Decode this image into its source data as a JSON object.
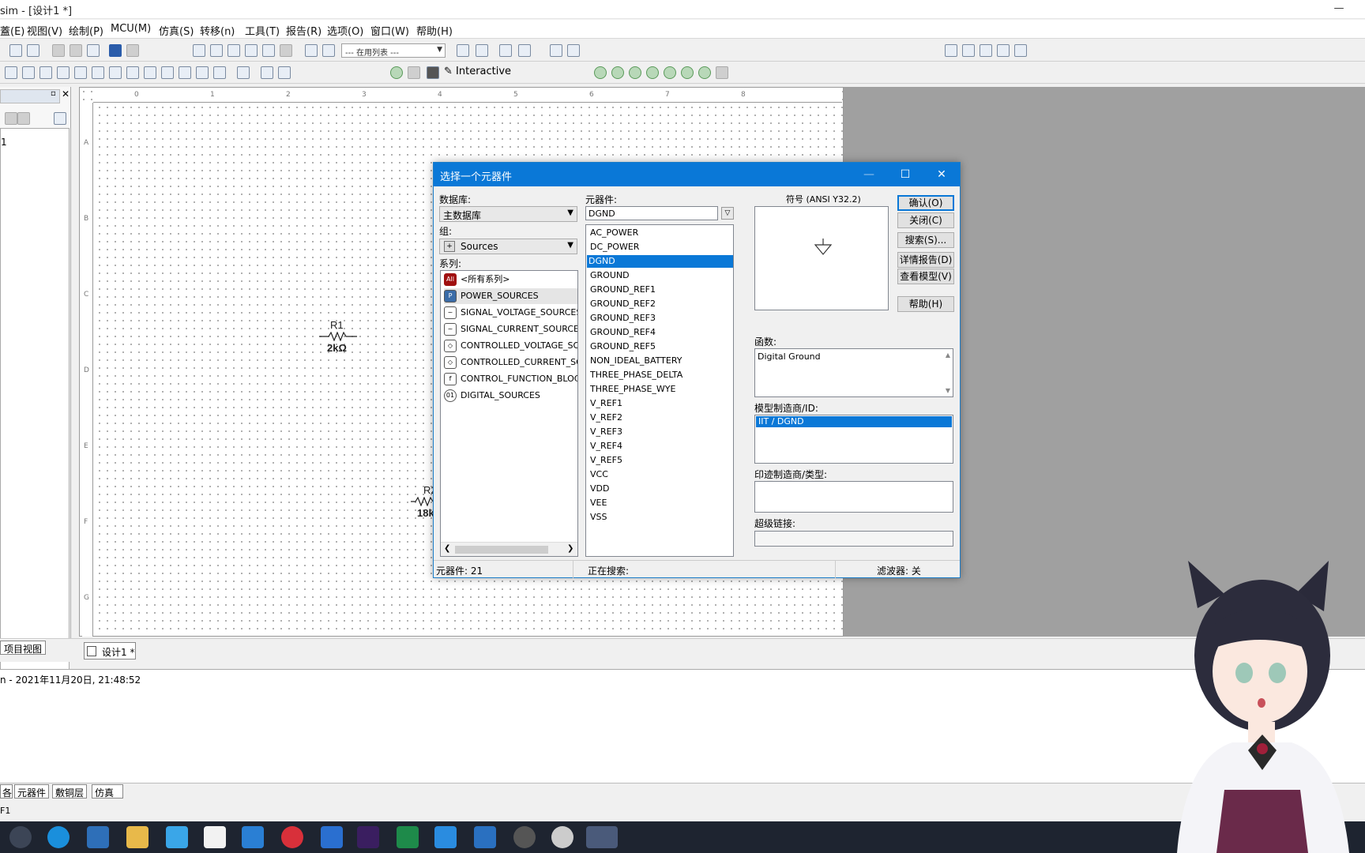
{
  "window": {
    "title": "sim - [设计1 *]",
    "minimize": "—"
  },
  "menu": [
    "蓋(E)",
    "视图(V)",
    "绘制(P)",
    "MCU(M)",
    "仿真(S)",
    "转移(n)",
    "工具(T)",
    "报告(R)",
    "选项(O)",
    "窗口(W)",
    "帮助(H)"
  ],
  "toolbar": {
    "in_use_list": "--- 在用列表 ---",
    "interactive": "Interactive"
  },
  "left_panel": {
    "tab": "项目视图",
    "item": "1"
  },
  "canvas": {
    "ruler_top": [
      "0",
      "1",
      "2",
      "3",
      "4",
      "5",
      "6",
      "7",
      "8"
    ],
    "ruler_left": [
      "A",
      "B",
      "C",
      "D",
      "E",
      "F",
      "G"
    ],
    "components": {
      "r1_name": "R1",
      "r1_value": "2kΩ",
      "r2_name": "R2",
      "r2_value": "18k"
    }
  },
  "doc_tab": "设计1 *",
  "log": {
    "line": "n  -  2021年11月20日, 21:48:52"
  },
  "bottom_tabs": [
    "各",
    "元器件",
    "敷铜层",
    "仿真"
  ],
  "status": {
    "left": "F1"
  },
  "dialog": {
    "title": "选择一个元器件",
    "database_label": "数据库:",
    "database_value": "主数据库",
    "group_label": "组:",
    "group_value": "Sources",
    "family_label": "系列:",
    "families": [
      "<所有系列>",
      "POWER_SOURCES",
      "SIGNAL_VOLTAGE_SOURCES",
      "SIGNAL_CURRENT_SOURCES",
      "CONTROLLED_VOLTAGE_SOUR",
      "CONTROLLED_CURRENT_SOU",
      "CONTROL_FUNCTION_BLOCKS",
      "DIGITAL_SOURCES"
    ],
    "component_label": "元器件:",
    "component_value": "DGND",
    "components": [
      "AC_POWER",
      "DC_POWER",
      "DGND",
      "GROUND",
      "GROUND_REF1",
      "GROUND_REF2",
      "GROUND_REF3",
      "GROUND_REF4",
      "GROUND_REF5",
      "NON_IDEAL_BATTERY",
      "THREE_PHASE_DELTA",
      "THREE_PHASE_WYE",
      "V_REF1",
      "V_REF2",
      "V_REF3",
      "V_REF4",
      "V_REF5",
      "VCC",
      "VDD",
      "VEE",
      "VSS"
    ],
    "symbol_label": "符号 (ANSI Y32.2)",
    "function_label": "函数:",
    "function_value": "Digital Ground",
    "model_label": "模型制造商/ID:",
    "model_value": "IIT / DGND",
    "footprint_label": "印迹制造商/类型:",
    "hyperlink_label": "超级链接:",
    "buttons": {
      "ok": "确认(O)",
      "close": "关闭(C)",
      "search": "搜索(S)...",
      "detail": "详情报告(D)",
      "view_model": "查看模型(V)",
      "help": "帮助(H)"
    },
    "status": {
      "count": "元器件: 21",
      "searching": "正在搜索:",
      "filter": "滤波器: 关"
    }
  },
  "colors": {
    "accent": "#0a78d7",
    "taskbar": "#1e2430",
    "workspace_gray": "#a0a0a0"
  }
}
